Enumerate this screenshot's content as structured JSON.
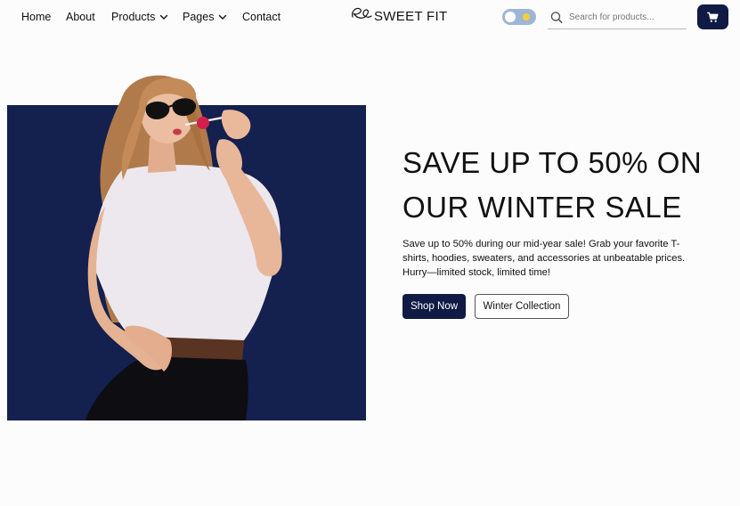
{
  "nav": {
    "links": [
      {
        "label": "Home"
      },
      {
        "label": "About"
      },
      {
        "label": "Products",
        "has_dropdown": true
      },
      {
        "label": "Pages",
        "has_dropdown": true
      },
      {
        "label": "Contact"
      }
    ]
  },
  "logo": {
    "text": "SWEET FIT",
    "icon": "script-logo-icon"
  },
  "theme_toggle": {
    "state": "light",
    "icon": "sun-icon"
  },
  "search": {
    "placeholder": "Search for products...",
    "value": "",
    "icon": "search-icon"
  },
  "cart": {
    "icon": "cart-icon",
    "color": "#0f1a45"
  },
  "hero": {
    "title_line1": "SAVE UP TO 50% ON",
    "title_line2": "OUR WINTER SALE",
    "description": "Save up to 50% during our mid-year sale! Grab your favorite T-shirts, hoodies, sweaters, and accessories at unbeatable prices. Hurry—limited stock, limited time!",
    "primary_button": "Shop Now",
    "secondary_button": "Winter Collection",
    "panel_color": "#14204d",
    "accent_color": "#0f1a45"
  }
}
